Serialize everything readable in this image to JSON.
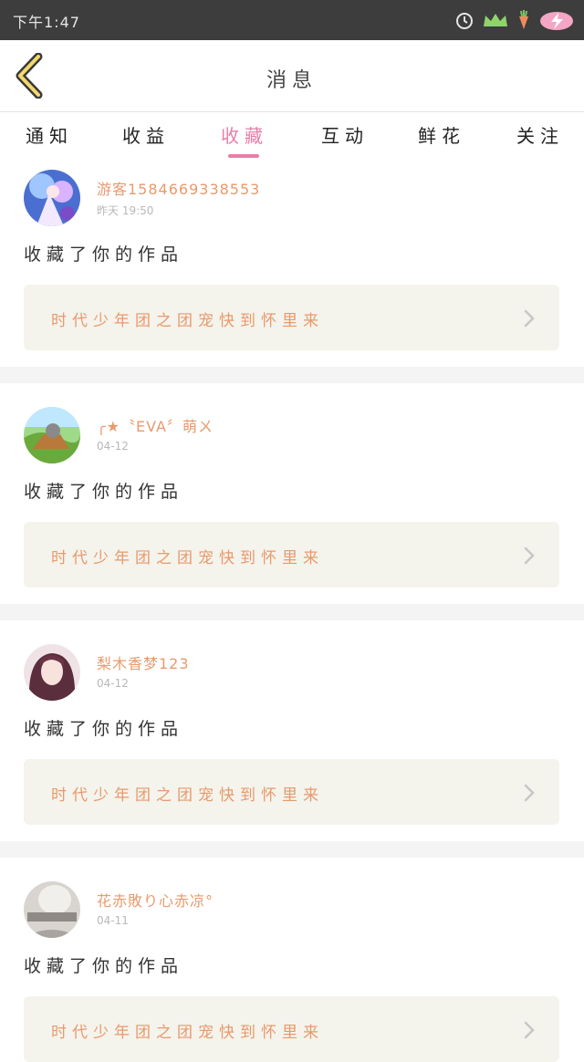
{
  "status_bar": {
    "time": "下午1:47"
  },
  "header": {
    "title": "消息"
  },
  "tabs": [
    {
      "label": "通知",
      "active": false
    },
    {
      "label": "收益",
      "active": false
    },
    {
      "label": "收藏",
      "active": true
    },
    {
      "label": "互动",
      "active": false
    },
    {
      "label": "鲜花",
      "active": false
    },
    {
      "label": "关注",
      "active": false
    }
  ],
  "colors": {
    "accent": "#e87ea8",
    "username": "#e89a6c",
    "box_bg": "#f4f3ec",
    "status_bar": "#3d3d3d"
  },
  "messages": [
    {
      "username": "游客1584669338553",
      "time": "昨天 19:50",
      "action": "收藏了你的作品",
      "work_title": "时代少年团之团宠快到怀里来",
      "avatar": "avatar-anime-blue"
    },
    {
      "username": "╭★〝EVA〞萌ㄨ",
      "time": "04-12",
      "action": "收藏了你的作品",
      "work_title": "时代少年团之团宠快到怀里来",
      "avatar": "avatar-anime-green"
    },
    {
      "username": "梨木香梦123",
      "time": "04-12",
      "action": "收藏了你的作品",
      "work_title": "时代少年团之团宠快到怀里来",
      "avatar": "avatar-anime-girl"
    },
    {
      "username": "花赤敗り心赤凉°",
      "time": "04-11",
      "action": "收藏了你的作品",
      "work_title": "时代少年团之团宠快到怀里来",
      "avatar": "avatar-sketch"
    }
  ]
}
